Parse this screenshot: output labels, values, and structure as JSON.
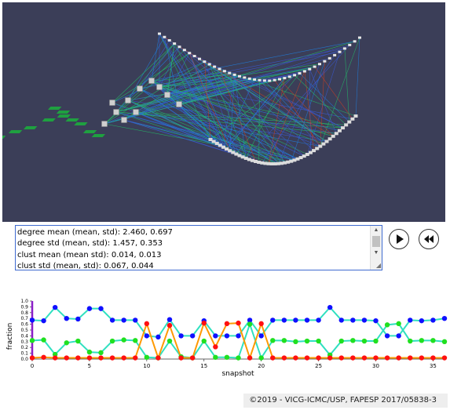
{
  "stats_box": {
    "lines": [
      "degree mean (mean, std): 2.460, 0.697",
      "degree std (mean, std): 1.457, 0.353",
      "clust mean (mean std): 0.014, 0.013",
      "clust std (mean, std): 0.067, 0.044"
    ]
  },
  "controls": {
    "play_icon": "play-icon",
    "rewind_icon": "rewind-icon"
  },
  "footer": {
    "text": "©2019 - VICG-ICMC/USP, FAPESP 2017/05838-3"
  },
  "viewport": {
    "background": "#3b3e58",
    "edge_colors": [
      "#22c06a",
      "#1f7fe0",
      "#3a5ad8",
      "#d04020"
    ]
  },
  "chart_data": {
    "type": "line",
    "title": "",
    "xlabel": "snapshot",
    "ylabel": "fraction",
    "xlim": [
      0,
      36
    ],
    "ylim": [
      0,
      1.0
    ],
    "xticks": [
      0,
      5,
      10,
      15,
      20,
      25,
      30,
      35
    ],
    "yticks": [
      "0.0",
      "0.1",
      "0.2",
      "0.3",
      "0.4",
      "0.5",
      "0.6",
      "0.7",
      "0.8",
      "0.9",
      "1.0"
    ],
    "x": [
      0,
      1,
      2,
      3,
      4,
      5,
      6,
      7,
      8,
      9,
      10,
      11,
      12,
      13,
      14,
      15,
      16,
      17,
      18,
      19,
      20,
      21,
      22,
      23,
      24,
      25,
      26,
      27,
      28,
      29,
      30,
      31,
      32,
      33,
      34,
      35,
      36
    ],
    "series": [
      {
        "color": "#1010ff",
        "line_color": "#30e0c0",
        "values": [
          0.67,
          0.66,
          0.89,
          0.7,
          0.69,
          0.87,
          0.87,
          0.67,
          0.67,
          0.67,
          0.4,
          0.38,
          0.68,
          0.4,
          0.4,
          0.66,
          0.4,
          0.4,
          0.4,
          0.67,
          0.4,
          0.67,
          0.67,
          0.67,
          0.67,
          0.67,
          0.89,
          0.67,
          0.67,
          0.67,
          0.66,
          0.4,
          0.4,
          0.67,
          0.66,
          0.67,
          0.7
        ]
      },
      {
        "color": "#20e020",
        "line_color": "#30e0c0",
        "values": [
          0.32,
          0.33,
          0.08,
          0.28,
          0.31,
          0.12,
          0.11,
          0.31,
          0.33,
          0.32,
          0.03,
          0.02,
          0.31,
          0.04,
          0.02,
          0.31,
          0.03,
          0.03,
          0.02,
          0.6,
          0.02,
          0.32,
          0.32,
          0.3,
          0.31,
          0.31,
          0.07,
          0.31,
          0.32,
          0.31,
          0.31,
          0.59,
          0.61,
          0.31,
          0.32,
          0.32,
          0.3
        ]
      },
      {
        "color": "#ff1010",
        "line_color": "#ff9900",
        "values": [
          0.02,
          0.03,
          0.02,
          0.02,
          0.02,
          0.02,
          0.02,
          0.02,
          0.02,
          0.02,
          0.61,
          0.02,
          0.58,
          0.02,
          0.02,
          0.62,
          0.21,
          0.61,
          0.62,
          0.02,
          0.61,
          0.02,
          0.02,
          0.02,
          0.02,
          0.02,
          0.02,
          0.02,
          0.02,
          0.02,
          0.02,
          0.02,
          0.02,
          0.02,
          0.02,
          0.02,
          0.02
        ]
      }
    ]
  }
}
